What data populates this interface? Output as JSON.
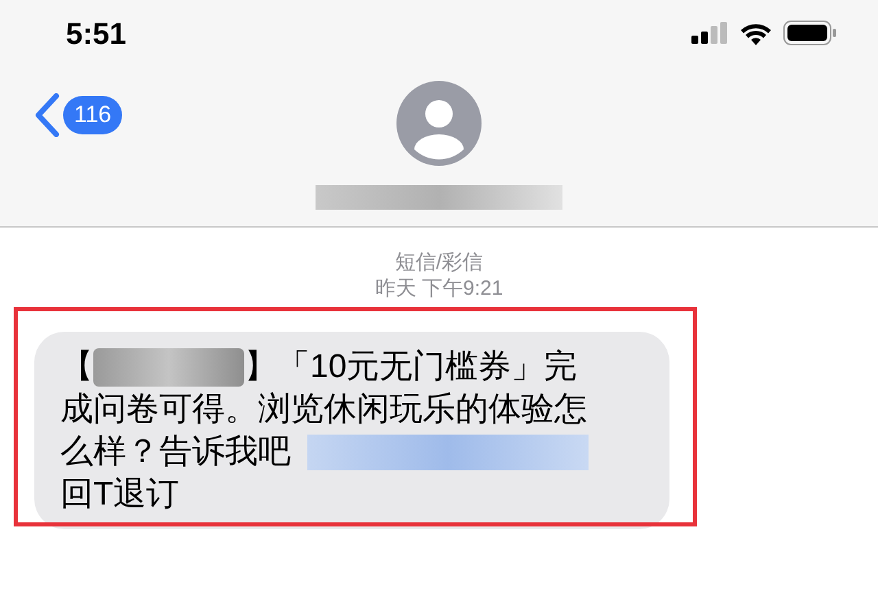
{
  "status_bar": {
    "time": "5:51"
  },
  "header": {
    "back_badge": "116",
    "contact_name": {
      "kind": "redacted"
    }
  },
  "meta": {
    "service": "短信/彩信",
    "timestamp": "昨天 下午9:21"
  },
  "message": {
    "highlighted": true,
    "lines": [
      [
        {
          "kind": "text",
          "text": "【"
        },
        {
          "kind": "redacted"
        },
        {
          "kind": "text",
          "text": "】「10元无门槛券」完"
        }
      ],
      [
        {
          "kind": "text",
          "text": "成问卷可得。浏览休闲玩乐的体验怎"
        }
      ],
      [
        {
          "kind": "text",
          "text": "么样？告诉我吧"
        },
        {
          "kind": "redacted_link"
        }
      ],
      [
        {
          "kind": "text",
          "text": "回T退订"
        }
      ]
    ]
  }
}
